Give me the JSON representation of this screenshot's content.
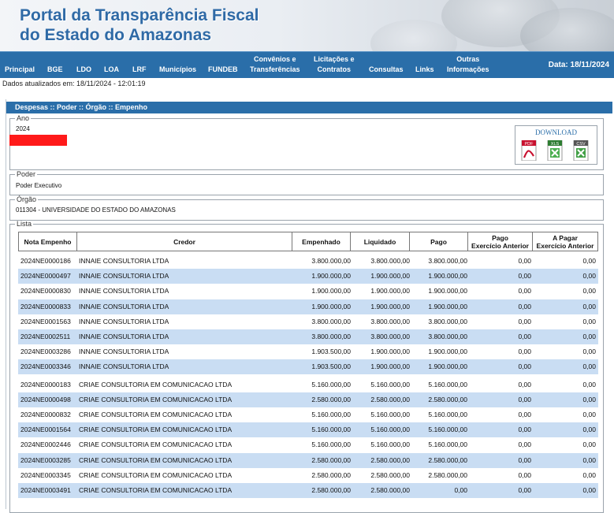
{
  "header": {
    "title_line1": "Portal da Transparência Fiscal",
    "title_line2": "do Estado do Amazonas"
  },
  "nav": {
    "items": [
      "Principal",
      "BGE",
      "LDO",
      "LOA",
      "LRF",
      "Municípios",
      "FUNDEB",
      "Convênios e\nTransferências",
      "Licitações e\nContratos",
      "Consultas",
      "Links",
      "Outras\nInformações"
    ],
    "date": "Data: 18/11/2024"
  },
  "updated": "Dados atualizados em: 18/11/2024 - 12:01:19",
  "panel": {
    "title": "Despesas :: Poder :: Órgão :: Empenho",
    "ano_legend": "Ano",
    "ano_value": "2024",
    "poder_legend": "Poder",
    "poder_value": "Poder Executivo",
    "orgao_legend": "Órgão",
    "orgao_value": "011304 - UNIVERSIDADE DO ESTADO DO AMAZONAS",
    "lista_legend": "Lista",
    "download": {
      "label": "DOWNLOAD",
      "pdf": "PDF",
      "xls": "XLS",
      "csv": "CSV"
    }
  },
  "table": {
    "headers": [
      "Nota Empenho",
      "Credor",
      "Empenhado",
      "Liquidado",
      "Pago",
      "Pago\nExercício Anterior",
      "A Pagar\nExercício Anterior"
    ],
    "rows": [
      [
        "2024NE0000186",
        "INNAIE CONSULTORIA LTDA",
        "3.800.000,00",
        "3.800.000,00",
        "3.800.000,00",
        "0,00",
        "0,00"
      ],
      [
        "2024NE0000497",
        "INNAIE CONSULTORIA LTDA",
        "1.900.000,00",
        "1.900.000,00",
        "1.900.000,00",
        "0,00",
        "0,00"
      ],
      [
        "2024NE0000830",
        "INNAIE CONSULTORIA LTDA",
        "1.900.000,00",
        "1.900.000,00",
        "1.900.000,00",
        "0,00",
        "0,00"
      ],
      [
        "2024NE0000833",
        "INNAIE CONSULTORIA LTDA",
        "1.900.000,00",
        "1.900.000,00",
        "1.900.000,00",
        "0,00",
        "0,00"
      ],
      [
        "2024NE0001563",
        "INNAIE CONSULTORIA LTDA",
        "3.800.000,00",
        "3.800.000,00",
        "3.800.000,00",
        "0,00",
        "0,00"
      ],
      [
        "2024NE0002511",
        "INNAIE CONSULTORIA LTDA",
        "3.800.000,00",
        "3.800.000,00",
        "3.800.000,00",
        "0,00",
        "0,00"
      ],
      [
        "2024NE0003286",
        "INNAIE CONSULTORIA LTDA",
        "1.903.500,00",
        "1.900.000,00",
        "1.900.000,00",
        "0,00",
        "0,00"
      ],
      [
        "2024NE0003346",
        "INNAIE CONSULTORIA LTDA",
        "1.903.500,00",
        "1.900.000,00",
        "1.900.000,00",
        "0,00",
        "0,00"
      ],
      [
        "2024NE0000183",
        "CRIAE CONSULTORIA EM COMUNICACAO LTDA",
        "5.160.000,00",
        "5.160.000,00",
        "5.160.000,00",
        "0,00",
        "0,00"
      ],
      [
        "2024NE0000498",
        "CRIAE CONSULTORIA EM COMUNICACAO LTDA",
        "2.580.000,00",
        "2.580.000,00",
        "2.580.000,00",
        "0,00",
        "0,00"
      ],
      [
        "2024NE0000832",
        "CRIAE CONSULTORIA EM COMUNICACAO LTDA",
        "5.160.000,00",
        "5.160.000,00",
        "5.160.000,00",
        "0,00",
        "0,00"
      ],
      [
        "2024NE0001564",
        "CRIAE CONSULTORIA EM COMUNICACAO LTDA",
        "5.160.000,00",
        "5.160.000,00",
        "5.160.000,00",
        "0,00",
        "0,00"
      ],
      [
        "2024NE0002446",
        "CRIAE CONSULTORIA EM COMUNICACAO LTDA",
        "5.160.000,00",
        "5.160.000,00",
        "5.160.000,00",
        "0,00",
        "0,00"
      ],
      [
        "2024NE0003285",
        "CRIAE CONSULTORIA EM COMUNICACAO LTDA",
        "2.580.000,00",
        "2.580.000,00",
        "2.580.000,00",
        "0,00",
        "0,00"
      ],
      [
        "2024NE0003345",
        "CRIAE CONSULTORIA EM COMUNICACAO LTDA",
        "2.580.000,00",
        "2.580.000,00",
        "2.580.000,00",
        "0,00",
        "0,00"
      ],
      [
        "2024NE0003491",
        "CRIAE CONSULTORIA EM COMUNICACAO LTDA",
        "2.580.000,00",
        "2.580.000,00",
        "0,00",
        "0,00",
        "0,00"
      ]
    ]
  },
  "colors": {
    "title_blue": "#2f6aa6",
    "nav_blue": "#2a6ea9",
    "row_alt": "#c9ddf3",
    "redact": "#ff1a1a"
  }
}
